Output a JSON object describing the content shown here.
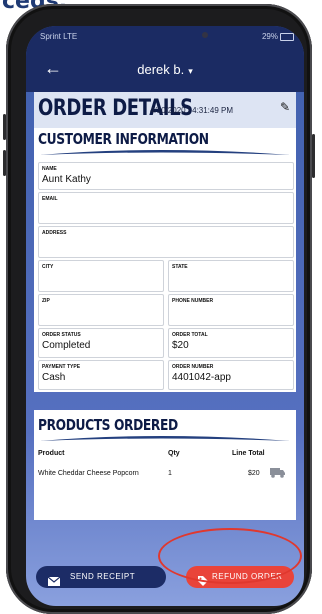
{
  "caption": {
    "text": "ceds."
  },
  "status_bar": {
    "carrier": "Sprint LTE",
    "battery": "29%"
  },
  "nav": {
    "back_icon": "arrow-left-icon",
    "user": "derek b.",
    "caret": "▾"
  },
  "order": {
    "title": "ORDER DETAILS",
    "datetime": "4/10/2020 | 4:31:49 PM",
    "edit_icon": "pencil-icon"
  },
  "customer": {
    "title": "CUSTOMER INFORMATION",
    "fields": {
      "name": {
        "label": "NAME",
        "value": "Aunt Kathy"
      },
      "email": {
        "label": "EMAIL",
        "value": ""
      },
      "address": {
        "label": "ADDRESS",
        "value": ""
      },
      "city": {
        "label": "CITY",
        "value": ""
      },
      "state": {
        "label": "STATE",
        "value": ""
      },
      "zip": {
        "label": "ZIP",
        "value": ""
      },
      "phone": {
        "label": "PHONE NUMBER",
        "value": ""
      },
      "status": {
        "label": "ORDER STATUS",
        "value": "Completed"
      },
      "total": {
        "label": "ORDER TOTAL",
        "value": "$20"
      },
      "payment": {
        "label": "PAYMENT TYPE",
        "value": "Cash"
      },
      "number": {
        "label": "ORDER NUMBER",
        "value": "4401042-app"
      }
    }
  },
  "products": {
    "title": "PRODUCTS ORDERED",
    "columns": [
      "Product",
      "Qty",
      "Line Total"
    ],
    "rows": [
      {
        "product": "White Cheddar Cheese Popcorn",
        "qty": "1",
        "total": "$20",
        "icon": "truck-icon"
      }
    ]
  },
  "actions": {
    "send_receipt": "SEND RECEIPT",
    "refund_order": "REFUND ORDER"
  },
  "colors": {
    "navy": "#1b2b63",
    "accent": "#e9443a",
    "brand_blue": "#3f5fad"
  }
}
